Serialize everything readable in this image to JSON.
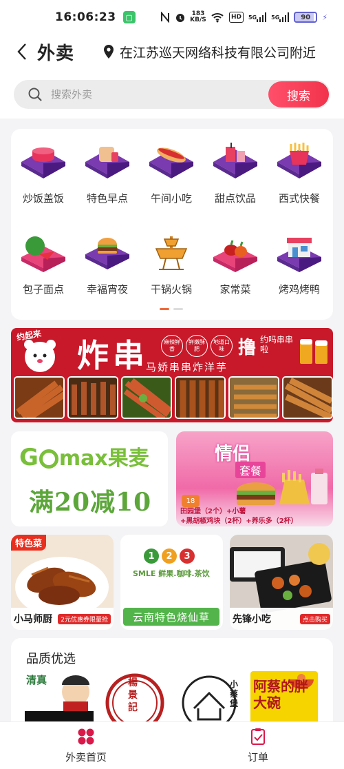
{
  "status_bar": {
    "time": "16:06:23",
    "net_speed": "183\nKB/S",
    "hd": "HD",
    "signal1": "5G",
    "signal2": "5G",
    "battery": "90"
  },
  "header": {
    "title": "外卖",
    "location": "在江苏巡天网络科技有限公司附近"
  },
  "search": {
    "placeholder": "搜索外卖",
    "button": "搜索"
  },
  "categories": [
    {
      "label": "炒饭盖饭",
      "icon": "pot-icon"
    },
    {
      "label": "特色早点",
      "icon": "breakfast-icon"
    },
    {
      "label": "午间小吃",
      "icon": "hotdog-icon"
    },
    {
      "label": "甜点饮品",
      "icon": "drink-icon"
    },
    {
      "label": "西式快餐",
      "icon": "fries-icon"
    },
    {
      "label": "包子面点",
      "icon": "watermelon-icon"
    },
    {
      "label": "幸福宵夜",
      "icon": "burger-icon"
    },
    {
      "label": "干锅火锅",
      "icon": "hotpot-icon"
    },
    {
      "label": "家常菜",
      "icon": "vegetable-icon"
    },
    {
      "label": "烤鸡烤鸭",
      "icon": "shop-icon"
    }
  ],
  "banner": {
    "title": "炸串",
    "subtitle": "马娇串串炸洋芋",
    "tags": [
      "麻辣鲜香",
      "鲜嫩酥肥",
      "地道口味"
    ],
    "slogan_big": "撸",
    "slogan_small": "约吗串串啦",
    "bear_text": "约起来"
  },
  "promo_tiles": {
    "gomax_brand": "max果麦",
    "gomax_offer": "满20减10",
    "couple_title": "情侣",
    "couple_sub": "套餐",
    "couple_price": "18",
    "couple_lines": [
      "田园堡（2个）+小薯",
      "+黑胡椒鸡块（2杯）+养乐多（2杯）"
    ]
  },
  "shop_tiles": [
    {
      "name": "小马师厨",
      "badge": "特色菜",
      "coupon": "2元优惠券限量抢"
    },
    {
      "name": "云南特色烧仙草",
      "brand": "SMLE 鲜果.咖啡.茶饮",
      "digits": [
        "1",
        "2",
        "3"
      ]
    },
    {
      "name": "先锋小吃",
      "coupon": "点击购买"
    }
  ],
  "quality": {
    "title": "品质优选",
    "brands": [
      "清真",
      "楊景記",
      "小蔡堡",
      "阿蔡的胖大碗"
    ]
  },
  "tabbar": {
    "home": "外卖首页",
    "orders": "订单"
  },
  "colors": {
    "accent": "#f2334c",
    "banner_red": "#c8192a",
    "purple": "#6b3fa0",
    "green": "#5ca63a"
  }
}
